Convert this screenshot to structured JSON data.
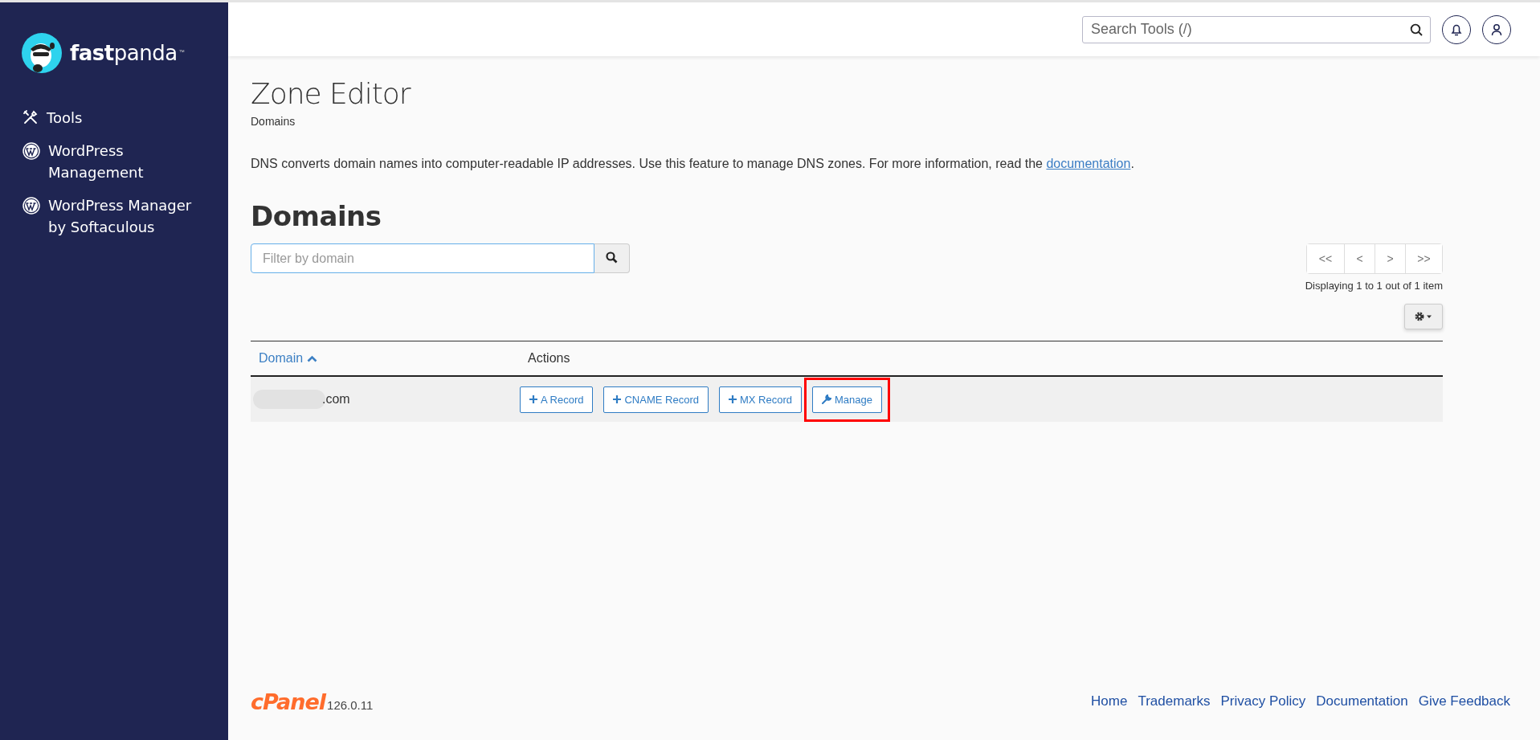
{
  "brand": {
    "name": "**fast**panda",
    "trademark": "™"
  },
  "sidebar": {
    "items": [
      {
        "label": "Tools",
        "kind": "tools"
      },
      {
        "label": "WordPress Management",
        "kind": "wordpress"
      },
      {
        "label": "WordPress Manager by Softaculous",
        "kind": "wordpress"
      }
    ]
  },
  "header": {
    "search": {
      "placeholder": "Search Tools (/)"
    }
  },
  "page": {
    "title": "Zone Editor",
    "breadcrumb": "Domains",
    "description": "DNS converts domain names into computer-readable IP addresses. Use this feature to manage DNS zones. For more information, read the ",
    "description_link": "documentation",
    "description_end": "."
  },
  "domains": {
    "heading": "Domains",
    "filter": {
      "placeholder": "Filter by domain"
    },
    "pagination": [
      "<<",
      "<",
      ">",
      ">>"
    ],
    "display_info": "Displaying 1 to 1 out of 1 item",
    "columns": [
      {
        "label": "Domain",
        "sorted": true
      },
      {
        "label": "Actions",
        "sorted": false
      }
    ],
    "rows": [
      {
        "domain": ".com",
        "redacted": true,
        "actions": [
          {
            "label": "A Record",
            "kind": "add",
            "highlighted": false
          },
          {
            "label": "CNAME Record",
            "kind": "add",
            "highlighted": false
          },
          {
            "label": "MX Record",
            "kind": "add",
            "highlighted": false
          },
          {
            "label": "Manage",
            "kind": "manage",
            "highlighted": true
          }
        ]
      }
    ]
  },
  "footer": {
    "logo": "cPanel",
    "version": "126.0.11",
    "links": [
      "Home",
      "Trademarks",
      "Privacy Policy",
      "Documentation",
      "Give Feedback"
    ]
  }
}
